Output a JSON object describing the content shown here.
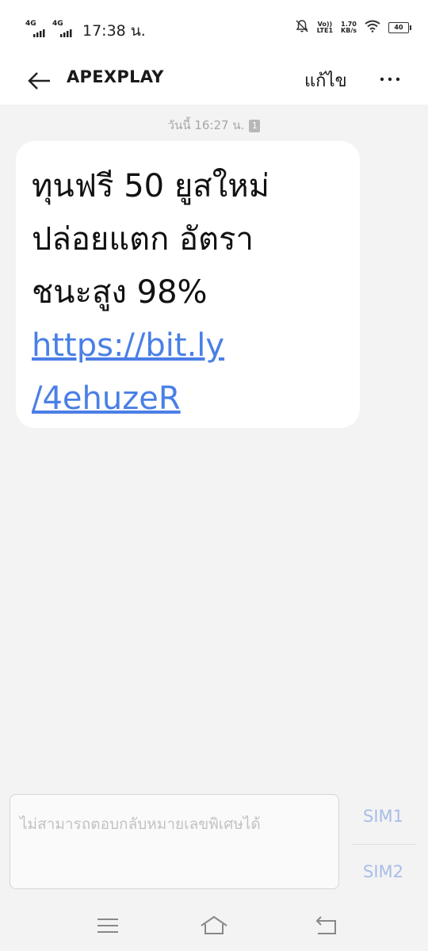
{
  "status_bar": {
    "network1": "4G",
    "network2": "4G",
    "time": "17:38 น.",
    "volte": "Vo))",
    "lte": "LTE1",
    "speed_value": "1.70",
    "speed_unit": "KB/s",
    "battery": "40",
    "icons": [
      "signal-icon",
      "mute-notification-icon",
      "wifi-icon",
      "battery-icon"
    ]
  },
  "header": {
    "title": "APEXPLAY",
    "edit_label": "แก้ไข",
    "icons": [
      "back-arrow-icon",
      "more-options-icon"
    ]
  },
  "conversation": {
    "timestamp": "วันนี้ 16:27 น.",
    "sim_badge": "1",
    "message": {
      "lines": [
        "ทุนฟรี 50 ยูสใหม่",
        "ปล่อยแตก อัตรา",
        "ชนะสูง 98%"
      ],
      "link_lines": [
        "https://bit.ly",
        "/4ehuzeR"
      ],
      "link_color": "#4a7fe6"
    }
  },
  "composer": {
    "placeholder": "ไม่สามารถตอบกลับหมายเลขพิเศษได้",
    "sim1_label": "SIM1",
    "sim2_label": "SIM2",
    "sim_color": "#a9bde8"
  },
  "nav_bar": {
    "icons": [
      "menu-icon",
      "home-icon",
      "back-icon"
    ]
  }
}
